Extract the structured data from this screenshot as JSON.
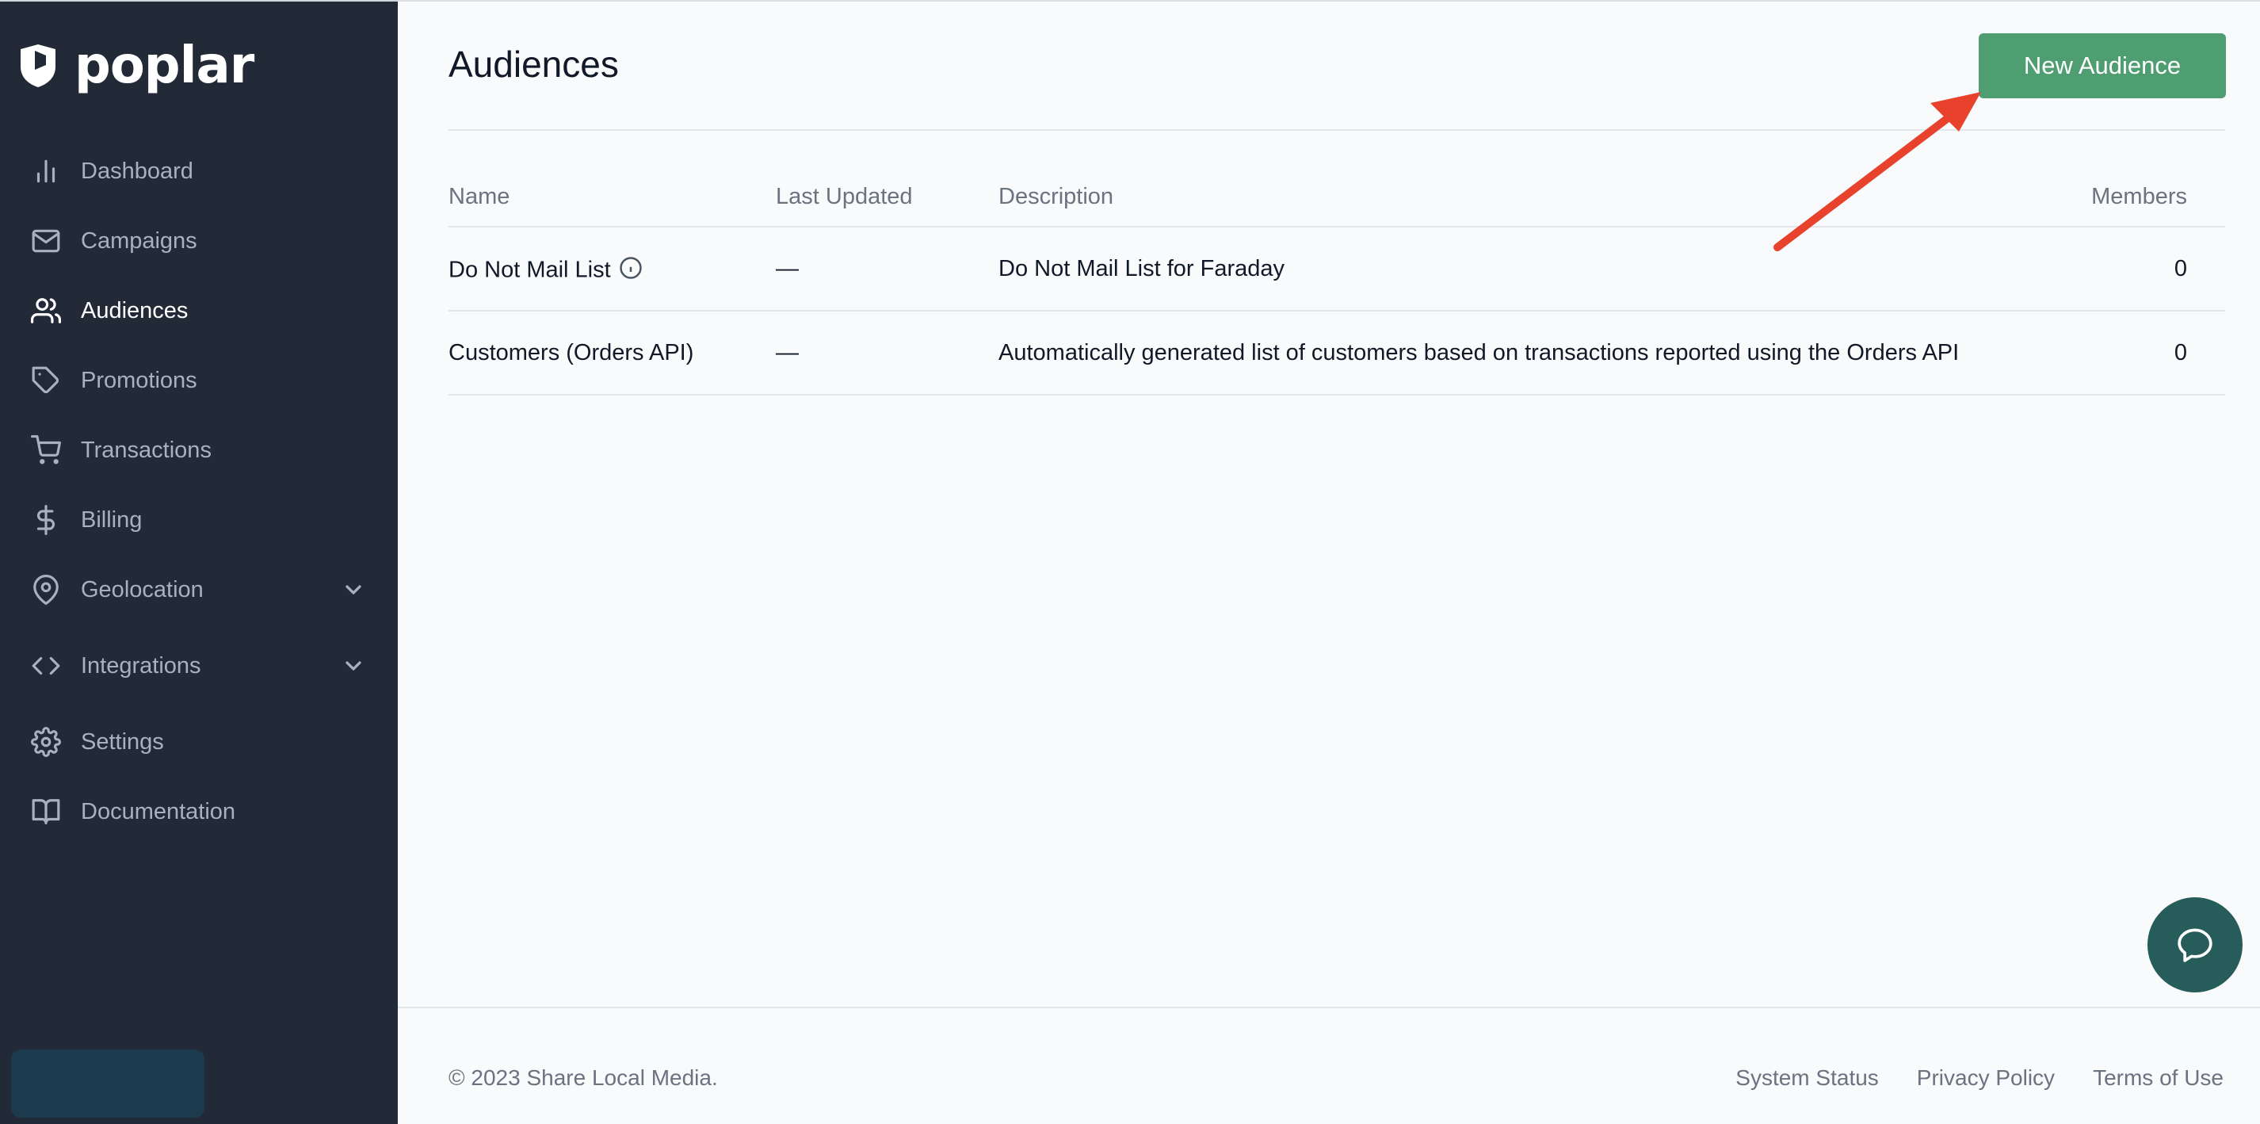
{
  "app": {
    "brand": "poplar"
  },
  "sidebar": {
    "items": [
      {
        "label": "Dashboard",
        "icon": "bar-chart-icon",
        "active": false
      },
      {
        "label": "Campaigns",
        "icon": "mail-icon",
        "active": false
      },
      {
        "label": "Audiences",
        "icon": "users-icon",
        "active": true
      },
      {
        "label": "Promotions",
        "icon": "tag-icon",
        "active": false
      },
      {
        "label": "Transactions",
        "icon": "cart-icon",
        "active": false
      },
      {
        "label": "Billing",
        "icon": "dollar-icon",
        "active": false
      },
      {
        "label": "Geolocation",
        "icon": "map-pin-icon",
        "active": false,
        "expandable": true
      },
      {
        "label": "Integrations",
        "icon": "code-icon",
        "active": false,
        "expandable": true
      },
      {
        "label": "Settings",
        "icon": "gear-icon",
        "active": false
      },
      {
        "label": "Documentation",
        "icon": "book-icon",
        "active": false
      }
    ]
  },
  "main": {
    "title": "Audiences",
    "new_button_label": "New Audience",
    "table": {
      "columns": [
        "Name",
        "Last Updated",
        "Description",
        "Members"
      ],
      "rows": [
        {
          "name": "Do Not Mail List",
          "last_updated": "—",
          "description": "Do Not Mail List for Faraday",
          "members": "0",
          "info": true
        },
        {
          "name": "Customers (Orders API)",
          "last_updated": "—",
          "description": "Automatically generated list of customers based on transactions reported using the Orders API",
          "members": "0",
          "info": false
        }
      ]
    }
  },
  "footer": {
    "copyright": "© 2023 Share Local Media.",
    "links": [
      "System Status",
      "Privacy Policy",
      "Terms of Use"
    ]
  },
  "colors": {
    "sidebar_bg": "#222a38",
    "accent_green": "#4f9e72",
    "chat_bg": "#265c5a",
    "annotation_arrow": "#e8412c"
  }
}
